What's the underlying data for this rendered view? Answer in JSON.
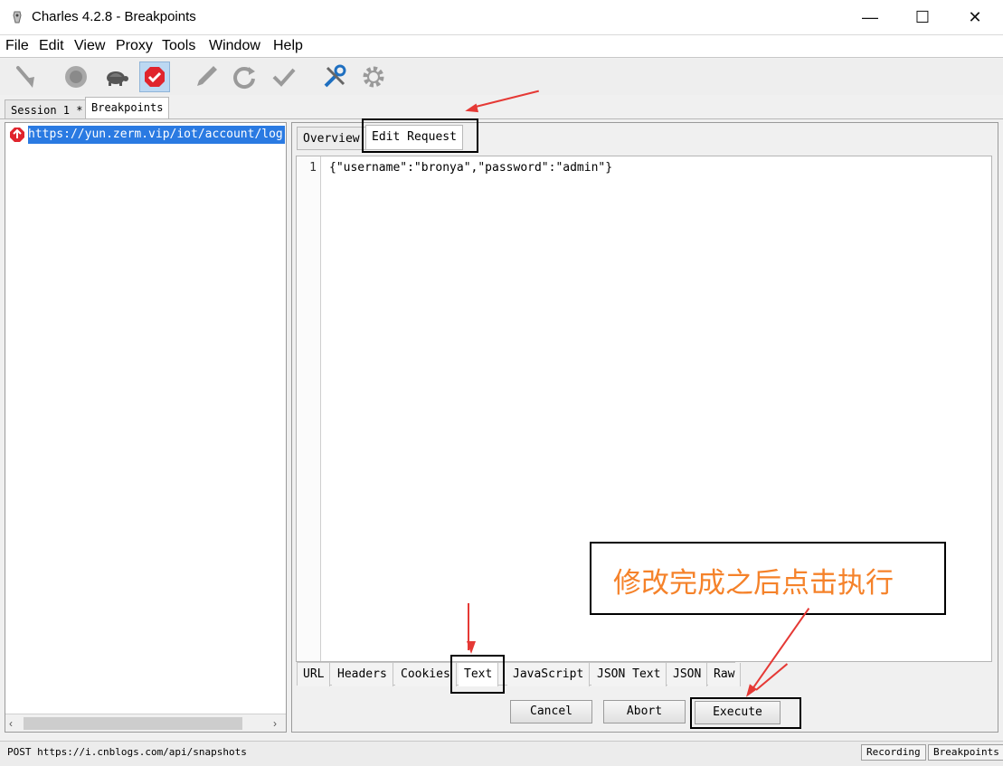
{
  "window": {
    "title": "Charles 4.2.8 - Breakpoints",
    "minimize": "—",
    "maximize": "☐",
    "close": "✕"
  },
  "menu": [
    "File",
    "Edit",
    "View",
    "Proxy",
    "Tools",
    "Window",
    "Help"
  ],
  "toolbar": [
    "broom-icon",
    "record-icon",
    "throttle-turtle-icon",
    "breakpoints-icon",
    "compose-pen-icon",
    "repeat-icon",
    "validate-check-icon",
    "tools-icon",
    "settings-gear-icon"
  ],
  "session_tabs": [
    "Session 1 *",
    "Breakpoints"
  ],
  "breakpoint_list": [
    {
      "url": "https://yun.zerm.vip/iot/account/log"
    }
  ],
  "request_tabs": [
    "Overview",
    "Edit Request"
  ],
  "editor": {
    "line_number": "1",
    "content": "{\"username\":\"bronya\",\"password\":\"admin\"}"
  },
  "body_tabs": [
    "URL",
    "Headers",
    "Cookies",
    "Text",
    "JavaScript",
    "JSON Text",
    "JSON",
    "Raw"
  ],
  "buttons": {
    "cancel": "Cancel",
    "abort": "Abort",
    "execute": "Execute"
  },
  "annotation": {
    "text": "修改完成之后点击执行",
    "color": "#f5822a"
  },
  "status_bar": {
    "text": "POST https://i.cnblogs.com/api/snapshots",
    "recording": "Recording",
    "breakpoints": "Breakpoints"
  },
  "colors": {
    "selection": "#2a7ae2",
    "highlight_red": "#e53935",
    "breakpoint_icon": "#e0242d"
  }
}
